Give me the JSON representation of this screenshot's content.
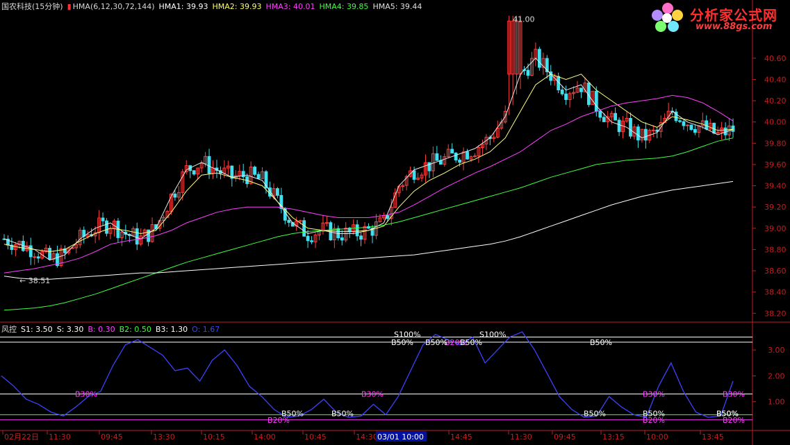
{
  "main_header": {
    "title": "国农科技(15分钟)",
    "indicator": "HMA(6,12,30,72,144)",
    "hma1": "HMA1: 39.93",
    "hma2": "HMA2: 39.93",
    "hma3": "HMA3: 40.01",
    "hma4": "HMA4: 39.85",
    "hma5": "HMA5: 39.44"
  },
  "sub_header": {
    "title": "风控",
    "s1": "S1: 3.50",
    "s": "S: 3.30",
    "b": "B: 0.30",
    "b2": "B2: 0.50",
    "b3": "B3: 1.30",
    "o": "O: 1.67"
  },
  "logo": {
    "text": "分析家公式网",
    "url_text": "www.88gs.com"
  },
  "colors": {
    "candle_up": "#ff4040",
    "candle_down": "#40e0f0",
    "hma1": "#e8e8e8",
    "hma2": "#ffff80",
    "hma3": "#ff40ff",
    "hma4": "#40ff40",
    "hma5": "#ffffff",
    "axis": "#c02020",
    "osc": "#4040ff"
  },
  "chart_data": [
    {
      "type": "candlestick",
      "title": "国农科技(15分钟)",
      "y_ticks": [
        "40.60",
        "40.40",
        "40.20",
        "40.00",
        "39.80",
        "39.60",
        "39.40",
        "39.20",
        "39.00",
        "38.80",
        "38.60",
        "38.40",
        "38.20"
      ],
      "ylim": [
        38.13,
        41.03
      ],
      "max_label": "41.00",
      "min_label": "38.51",
      "series": [
        {
          "name": "HMA1",
          "color": "#e8e8e8",
          "values": [
            38.9,
            38.85,
            38.8,
            38.7,
            38.75,
            38.9,
            39.0,
            39.05,
            38.95,
            38.9,
            39.0,
            39.3,
            39.55,
            39.62,
            39.55,
            39.48,
            39.5,
            39.45,
            39.25,
            39.05,
            38.95,
            38.98,
            38.95,
            38.95,
            38.98,
            39.05,
            39.4,
            39.55,
            39.6,
            39.65,
            39.7,
            39.75,
            39.85,
            40.05,
            40.45,
            40.6,
            40.45,
            40.3,
            40.35,
            40.15,
            40.0,
            39.95,
            39.85,
            39.9,
            40.1,
            40.0,
            39.95,
            39.88,
            39.93
          ]
        },
        {
          "name": "HMA2",
          "color": "#ffff80",
          "values": [
            38.85,
            38.82,
            38.8,
            38.78,
            38.8,
            38.88,
            38.95,
            39.0,
            38.98,
            38.95,
            38.98,
            39.15,
            39.35,
            39.5,
            39.52,
            39.48,
            39.45,
            39.4,
            39.25,
            39.1,
            39.0,
            38.98,
            38.97,
            38.97,
            38.98,
            39.02,
            39.2,
            39.35,
            39.45,
            39.52,
            39.6,
            39.65,
            39.72,
            39.85,
            40.1,
            40.35,
            40.45,
            40.4,
            40.45,
            40.3,
            40.2,
            40.1,
            40.0,
            39.95,
            40.05,
            40.02,
            39.98,
            39.92,
            39.93
          ]
        },
        {
          "name": "HMA3",
          "color": "#ff40ff",
          "values": [
            38.58,
            38.6,
            38.62,
            38.65,
            38.68,
            38.72,
            38.78,
            38.85,
            38.88,
            38.9,
            38.93,
            38.98,
            39.05,
            39.1,
            39.15,
            39.18,
            39.2,
            39.2,
            39.2,
            39.18,
            39.15,
            39.12,
            39.1,
            39.1,
            39.1,
            39.12,
            39.15,
            39.22,
            39.3,
            39.38,
            39.45,
            39.52,
            39.58,
            39.65,
            39.72,
            39.82,
            39.92,
            39.98,
            40.05,
            40.1,
            40.15,
            40.18,
            40.2,
            40.22,
            40.25,
            40.23,
            40.18,
            40.1,
            40.01
          ]
        },
        {
          "name": "HMA4",
          "color": "#40ff40",
          "values": [
            38.23,
            38.24,
            38.25,
            38.27,
            38.3,
            38.34,
            38.38,
            38.43,
            38.48,
            38.53,
            38.58,
            38.63,
            38.68,
            38.72,
            38.76,
            38.8,
            38.84,
            38.88,
            38.92,
            38.95,
            38.97,
            38.98,
            38.99,
            39.0,
            39.01,
            39.03,
            39.06,
            39.1,
            39.14,
            39.18,
            39.22,
            39.26,
            39.3,
            39.34,
            39.38,
            39.43,
            39.48,
            39.52,
            39.56,
            39.6,
            39.62,
            39.64,
            39.65,
            39.66,
            39.68,
            39.72,
            39.77,
            39.82,
            39.85
          ]
        },
        {
          "name": "HMA5",
          "color": "#ffffff",
          "values": [
            38.55,
            38.53,
            38.52,
            38.52,
            38.53,
            38.54,
            38.55,
            38.56,
            38.57,
            38.58,
            38.58,
            38.59,
            38.6,
            38.61,
            38.62,
            38.63,
            38.64,
            38.65,
            38.66,
            38.67,
            38.68,
            38.69,
            38.7,
            38.71,
            38.72,
            38.73,
            38.74,
            38.75,
            38.77,
            38.79,
            38.81,
            38.83,
            38.85,
            38.88,
            38.92,
            38.97,
            39.02,
            39.07,
            39.12,
            39.17,
            39.22,
            39.26,
            39.3,
            39.33,
            39.36,
            39.38,
            39.4,
            39.42,
            39.44
          ]
        }
      ]
    },
    {
      "type": "line",
      "title": "风控",
      "y_ticks": [
        "3.00",
        "2.00",
        "1.00"
      ],
      "ylim": [
        0.0,
        3.7
      ],
      "hlines": [
        {
          "value": 3.5,
          "color": "#ffffff"
        },
        {
          "value": 3.3,
          "color": "#ffffff"
        },
        {
          "value": 1.3,
          "color": "#ffffff"
        },
        {
          "value": 0.5,
          "color": "#40ff40"
        },
        {
          "value": 0.3,
          "color": "#ff40ff"
        }
      ],
      "series": [
        {
          "name": "O",
          "color": "#4040ff",
          "values": [
            2.0,
            1.6,
            1.1,
            0.9,
            0.6,
            0.45,
            0.8,
            1.2,
            1.4,
            2.4,
            3.2,
            3.4,
            3.1,
            2.8,
            2.2,
            2.3,
            1.8,
            2.6,
            3.0,
            2.4,
            1.6,
            1.2,
            0.7,
            0.4,
            0.45,
            0.7,
            1.1,
            0.6,
            0.4,
            0.45,
            0.9,
            0.5,
            1.2,
            2.2,
            3.2,
            3.6,
            3.4,
            3.2,
            3.5,
            2.5,
            3.0,
            3.5,
            3.7,
            3.0,
            2.1,
            1.2,
            0.7,
            0.4,
            0.45,
            1.2,
            0.8,
            0.5,
            0.4,
            1.6,
            2.5,
            1.4,
            0.6,
            0.4,
            0.45,
            1.8
          ]
        }
      ],
      "labels": [
        "B50%",
        "B30%",
        "B20%",
        "B50%",
        "B50%",
        "B20%",
        "B30%",
        "S100%",
        "B50%",
        "B50%",
        "B50%",
        "S100%",
        "B50%",
        "B50%",
        "B30%",
        "B20%",
        "B50%",
        "B30%",
        "B50%",
        "B20%"
      ]
    }
  ],
  "x_axis": {
    "labels": [
      "02月22日",
      "11:30",
      "09:45",
      "13:30",
      "10:15",
      "14:00",
      "10:45",
      "14:30",
      "03/01 10:00",
      "14:45",
      "11:30",
      "09:45",
      "13:15",
      "10:00",
      "13:45"
    ],
    "selected": "03/01 10:00"
  }
}
